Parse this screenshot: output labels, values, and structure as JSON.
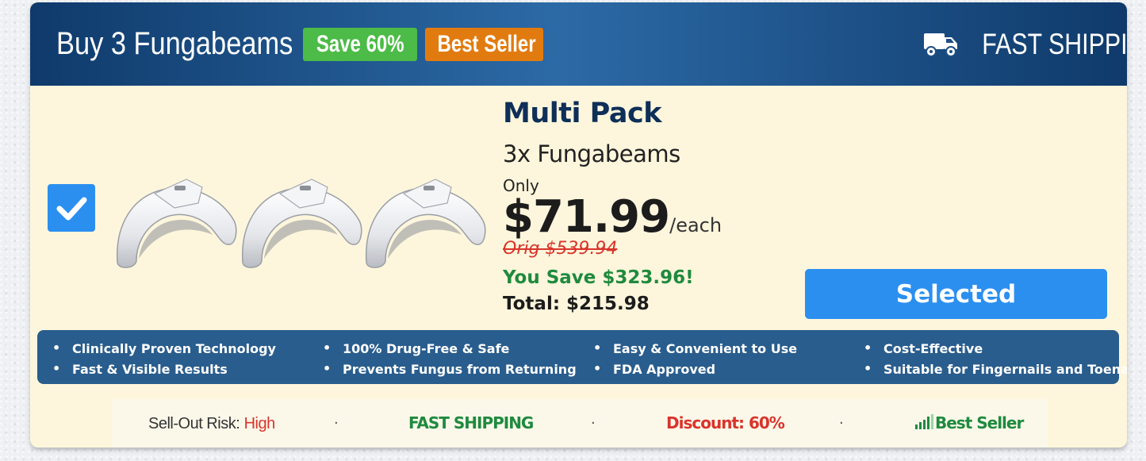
{
  "header": {
    "title": "Buy 3 Fungabeams",
    "badges": {
      "save": "Save 60%",
      "best_seller": "Best Seller"
    },
    "shipping_label": "FAST SHIPPING"
  },
  "product": {
    "checked": true,
    "pack_title": "Multi Pack",
    "pack_subtitle": "3x Fungabeams",
    "only_label": "Only",
    "price": "$71.99",
    "price_unit": "/each",
    "original_price": "Orig $539.94",
    "you_save": "You Save $323.96!",
    "total": "Total: $215.98",
    "select_button": "Selected"
  },
  "features": [
    "Clinically Proven Technology",
    "Fast & Visible Results",
    "100% Drug-Free & Safe",
    "Prevents Fungus from Returning",
    "Easy & Convenient to Use",
    "FDA Approved",
    "Cost-Effective",
    "Suitable for Fingernails and Toenails"
  ],
  "footer": {
    "risk_label": "Sell-Out Risk:",
    "risk_value": "High",
    "shipping": "FAST SHIPPING",
    "discount": "Discount: 60%",
    "best_seller": "Best Seller",
    "separator": "·"
  },
  "colors": {
    "header_dark": "#0f3a6b",
    "header_light": "#2c6aa6",
    "panel_bg": "#fdf6dc",
    "accent_blue": "#2b8ff0",
    "save_green": "#4cbb47",
    "best_orange": "#e27b0f",
    "features_bg": "#295d8d",
    "discount_red": "#d9342b",
    "savings_green": "#1f8a3e"
  },
  "icons": [
    "truck-icon",
    "checkmark-icon",
    "signal-bars-icon",
    "product-device-image"
  ]
}
